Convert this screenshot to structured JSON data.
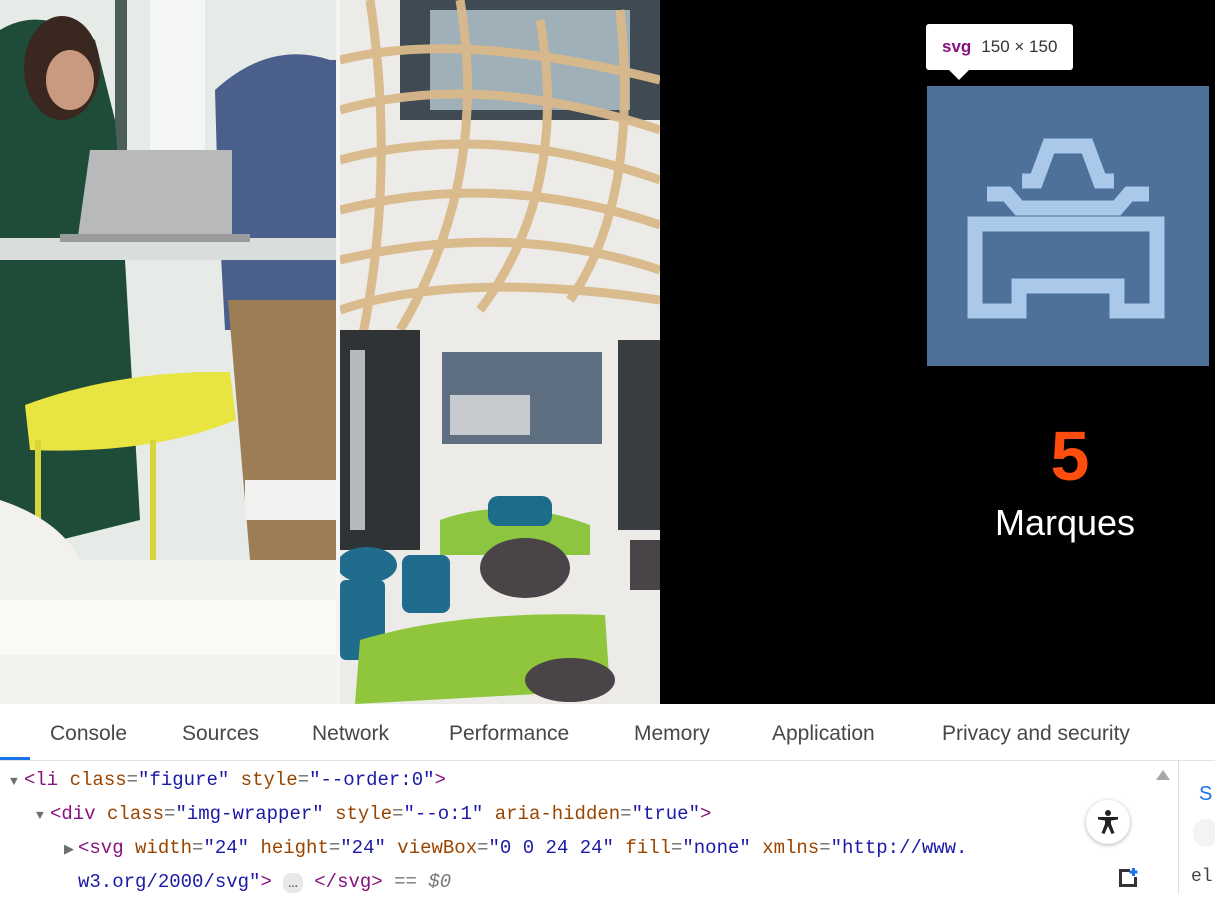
{
  "tooltip": {
    "tag": "svg",
    "dimensions": "150 × 150"
  },
  "stat": {
    "number": "5",
    "label": "Marques"
  },
  "devtools": {
    "tabs": [
      "Console",
      "Sources",
      "Network",
      "Performance",
      "Memory",
      "Application",
      "Privacy and security"
    ],
    "side_tab_letter": "S",
    "side_text": "el",
    "code": {
      "line1": {
        "tag_open": "<li",
        "attr1_name": "class",
        "attr1_value": "\"figure\"",
        "attr2_name": "style",
        "attr2_value": "\"--order:0\"",
        "tag_close": ">"
      },
      "line2": {
        "tag_open": "<div",
        "attr1_name": "class",
        "attr1_value": "\"img-wrapper\"",
        "attr2_name": "style",
        "attr2_value": "\"--o:1\"",
        "attr3_name": "aria-hidden",
        "attr3_value": "\"true\"",
        "tag_close": ">"
      },
      "line3": {
        "tag_open": "<svg",
        "attr1_name": "width",
        "attr1_value": "\"24\"",
        "attr2_name": "height",
        "attr2_value": "\"24\"",
        "attr3_name": "viewBox",
        "attr3_value": "\"0 0 24 24\"",
        "attr4_name": "fill",
        "attr4_value": "\"none\"",
        "attr5_name": "xmlns",
        "attr5_value": "\"http://www."
      },
      "line4": {
        "continuation": "w3.org/2000/svg\"",
        "tag_end": ">",
        "ellipsis": "…",
        "closing_tag": "</svg>",
        "selected_marker": "== $0"
      }
    }
  },
  "colors": {
    "icon_box": "#4d7198",
    "icon_stroke": "#a9c8ea",
    "stat_number": "#ff4d0d",
    "active_tab": "#1a73e8"
  },
  "icons": [
    "car-icon",
    "accessibility-icon",
    "expand-icon"
  ]
}
